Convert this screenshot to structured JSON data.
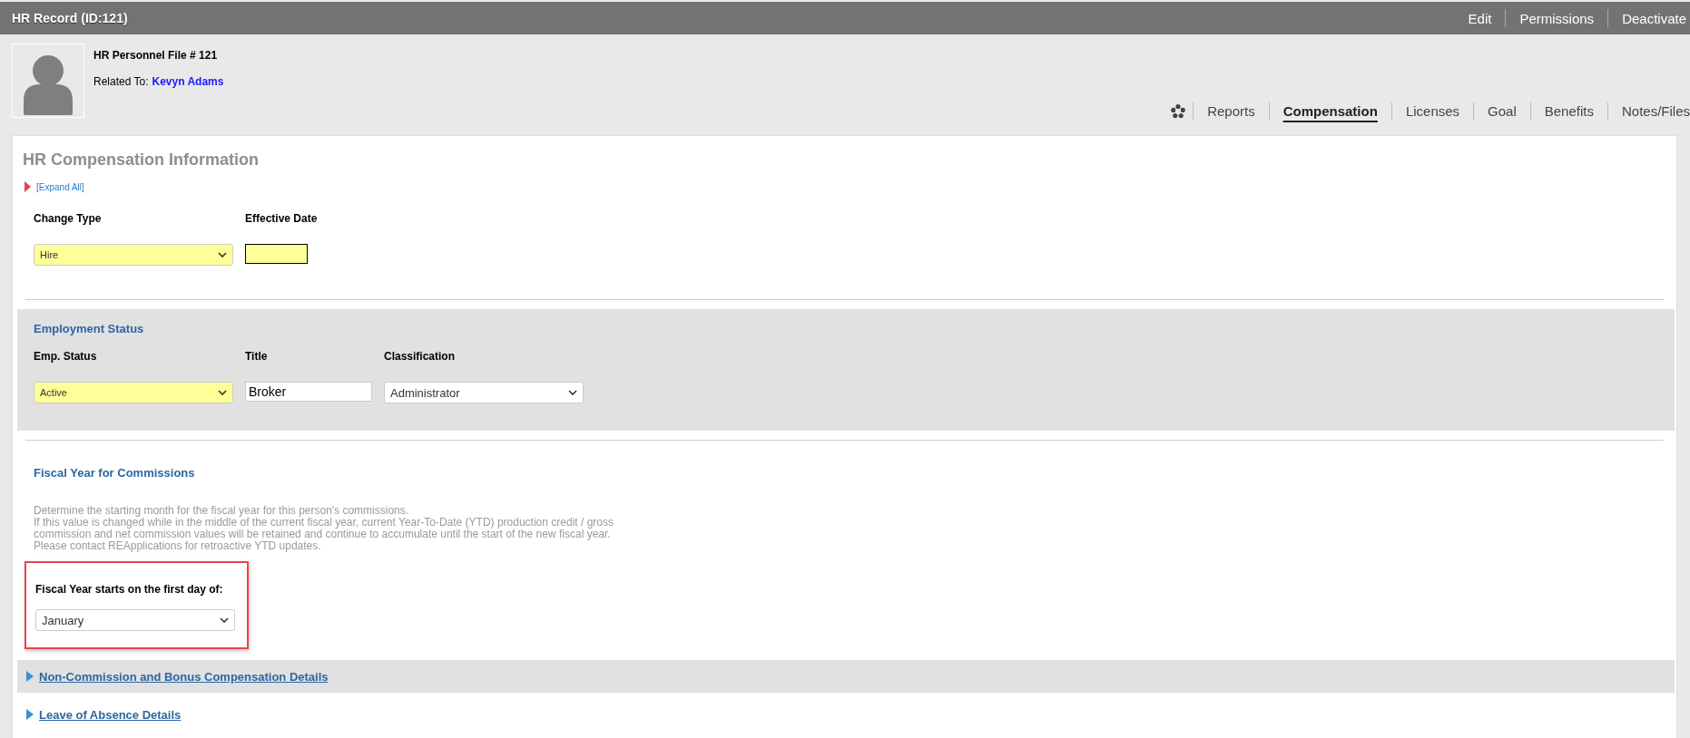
{
  "window": {
    "title": "HR Record (ID:121)"
  },
  "header_actions": [
    "Edit",
    "Permissions",
    "Deactivate"
  ],
  "profile": {
    "heading": "HR Personnel File # 121",
    "related_label": "Related To:",
    "related_name": "Kevyn Adams"
  },
  "tabs": [
    {
      "label": "Reports",
      "selected": false
    },
    {
      "label": "Compensation",
      "selected": true
    },
    {
      "label": "Licenses",
      "selected": false
    },
    {
      "label": "Goal",
      "selected": false
    },
    {
      "label": "Benefits",
      "selected": false
    },
    {
      "label": "Notes/Files",
      "selected": false
    }
  ],
  "section": {
    "title": "HR Compensation Information",
    "expand_label": "[Expand All]"
  },
  "change_fields": [
    {
      "kind": "select",
      "label": "Change Type",
      "value": "Hire",
      "required": true
    },
    {
      "kind": "date",
      "label": "Effective Date",
      "required": true
    }
  ],
  "employment": {
    "title": "Employment Status",
    "fields": [
      {
        "kind": "select",
        "label": "Emp. Status",
        "value": "Active",
        "required": true
      },
      {
        "kind": "text",
        "label": "Title",
        "value": "Broker",
        "required": false
      },
      {
        "kind": "select",
        "label": "Classification",
        "value": "Administrator",
        "required": false
      }
    ]
  },
  "fiscal": {
    "title": "Fiscal Year for Commissions",
    "description": [
      "Determine the starting month for the fiscal year for this person's commissions.",
      "If this value is changed while in the middle of the current fiscal year, current Year-To-Date (YTD) production credit / gross",
      "commission and net commission values will be retained and continue to accumulate until the start of the new fiscal year.",
      "Please contact REApplications for retroactive YTD updates."
    ],
    "field": {
      "kind": "select",
      "label": "Fiscal Year starts on the first day of:",
      "value": "January",
      "required": false,
      "highlighted": true
    }
  },
  "collapsibles": [
    {
      "label": "Non-Commission and Bonus Compensation Details",
      "shaded": true,
      "expanded": false
    },
    {
      "label": "Leave of Absence Details",
      "shaded": false,
      "expanded": false
    }
  ]
}
